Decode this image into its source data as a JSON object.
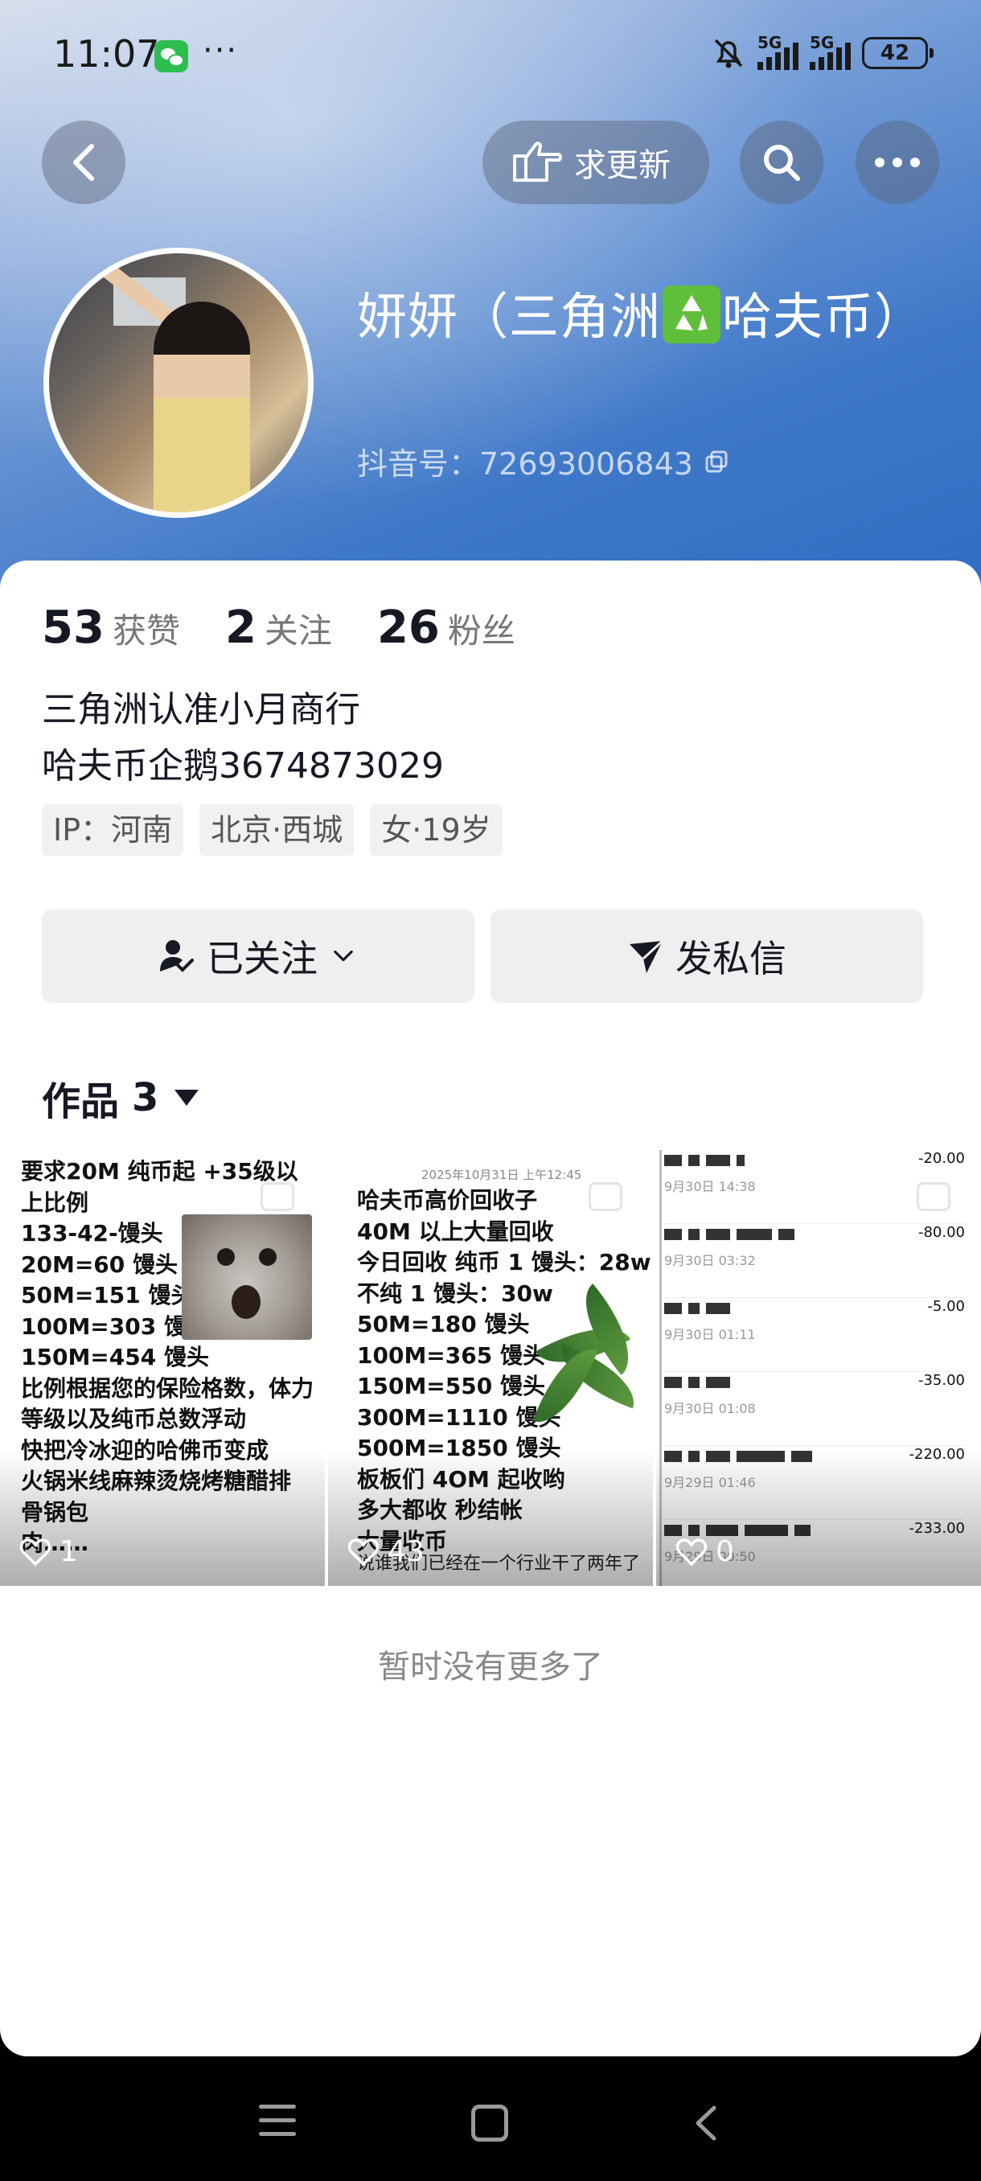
{
  "status_bar": {
    "time": "11:07",
    "more": "···",
    "net1": "5G",
    "net2": "5G",
    "battery": "42"
  },
  "nav": {
    "ask_update_label": "求更新"
  },
  "profile": {
    "name_part1": "妍妍（三角洲",
    "name_part2": "哈夫币）",
    "douyin_id": "抖音号：72693006843"
  },
  "stats": [
    {
      "num": "53",
      "label": "获赞"
    },
    {
      "num": "2",
      "label": "关注"
    },
    {
      "num": "26",
      "label": "粉丝"
    }
  ],
  "bio": {
    "line1": "三角洲认准小月商行",
    "line2": "哈夫币企鹅3674873029"
  },
  "tags": [
    "IP：河南",
    "北京·西城",
    "女·19岁"
  ],
  "actions": {
    "followed_label": "已关注",
    "message_label": "发私信"
  },
  "works": {
    "label": "作品",
    "count": "3"
  },
  "videos": [
    {
      "text": "要求20M 纯币起 +35级以\n上比例\n133-42-馒头\n20M=60 馒头\n50M=151 馒头\n100M=303 馒头\n150M=454 馒头\n比例根据您的保险格数，体力\n等级以及纯币总数浮动\n快把冷冰迎的哈佛币变成\n火锅米线麻辣烫烧烤糖醋排\n骨锅包\n肉……",
      "likes": "1"
    },
    {
      "date": "2025年10月31日 上午12:45",
      "text": "哈夫币高价回收子\n40M 以上大量回收\n今日回收 纯币 1 馒头：28w\n不纯 1 馒头：30w\n50M=180 馒头\n100M=365 馒头\n150M=550 馒头\n300M=1110 馒头\n500M=1850 馒头\n板板们 4OM 起收哟\n多大都收 秒结帐\n大量收币",
      "footer_text": "说谁我们已经在一个行业干了两年了",
      "likes": "43"
    },
    {
      "rows": [
        {
          "time": "9月30日 14:38",
          "amount": "-20.00"
        },
        {
          "time": "9月30日 03:32",
          "amount": "-80.00"
        },
        {
          "time": "9月30日 01:11",
          "amount": "-5.00"
        },
        {
          "time": "9月30日 01:08",
          "amount": "-35.00"
        },
        {
          "time": "9月29日 01:46",
          "amount": "-220.00"
        },
        {
          "time": "9月29日 00:50",
          "amount": "-233.00"
        }
      ],
      "likes": "0"
    }
  ],
  "footer": {
    "no_more": "暂时没有更多了"
  }
}
